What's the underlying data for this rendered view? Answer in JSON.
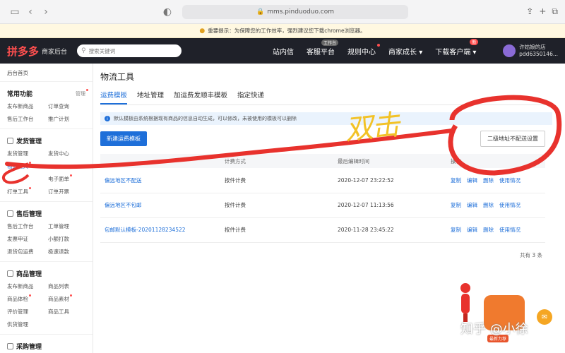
{
  "browser": {
    "url": "mms.pinduoduo.com"
  },
  "notice": {
    "text": "重要提示：为保障您的工作效率，强烈建议您下载chrome浏览器。"
  },
  "header": {
    "logo": "拼多多",
    "logo_sub": "商家后台",
    "search_placeholder": "搜索关键词",
    "nav": [
      {
        "label": "站内信"
      },
      {
        "label": "客服平台",
        "badge": "工作台"
      },
      {
        "label": "规则中心"
      },
      {
        "label": "商家成长 ▾"
      },
      {
        "label": "下载客户端 ▾",
        "tag": "新"
      }
    ],
    "user_name": "许姑娘的店",
    "user_id": "pdd6350146..."
  },
  "sidebar": {
    "home": "后台首页",
    "sections": [
      {
        "title": "常用功能",
        "manage": "管理",
        "items": [
          "发布新商品",
          "订单查询",
          "售后工作台",
          "推广计划"
        ]
      },
      {
        "title": "发货管理",
        "items": [
          "发货管理",
          "发货中心",
          "物流工具",
          "",
          "",
          "电子面单",
          "打单工具",
          "订单开票"
        ]
      },
      {
        "title": "售后管理",
        "items": [
          "售后工作台",
          "工单管理",
          "发票申证",
          "小额打款",
          "退货包运费",
          "极速退款"
        ]
      },
      {
        "title": "商品管理",
        "items": [
          "发布新商品",
          "商品列表",
          "商品体检",
          "商品素材",
          "评价管理",
          "商品工具",
          "供货管理"
        ]
      },
      {
        "title": "采购管理",
        "items": []
      }
    ]
  },
  "main": {
    "title": "物流工具",
    "tabs": [
      "运费模板",
      "地址管理",
      "加运费发顺丰模板",
      "指定快递"
    ],
    "info": "默认模板由系统根据现有商品的信息自动生成，可以修改，未被使用的模板可以删除",
    "new_button": "新建运费模板",
    "secondary_button": "二级地址不配送设置",
    "columns": [
      "",
      "计费方式",
      "最后编辑时间",
      "操作"
    ],
    "rows": [
      {
        "name": "偏远地区不配送",
        "billing": "按件计费",
        "time": "2020-12-07 23:22:52",
        "ops": [
          "复制",
          "编辑",
          "删除",
          "使用情况"
        ]
      },
      {
        "name": "偏远地区不包邮",
        "billing": "按件计费",
        "time": "2020-12-07 11:13:56",
        "ops": [
          "复制",
          "编辑",
          "删除",
          "使用情况"
        ]
      },
      {
        "name": "包邮默认模板-20201128234522",
        "billing": "按件计费",
        "time": "2020-11-28 23:45:22",
        "ops": [
          "复制",
          "编辑",
          "删除",
          "使用情况"
        ]
      }
    ],
    "total": "共有 3 条"
  },
  "overlay": {
    "handwriting": "双击",
    "watermark": "知乎 @小徐",
    "mascot_label": "最新力荐"
  }
}
